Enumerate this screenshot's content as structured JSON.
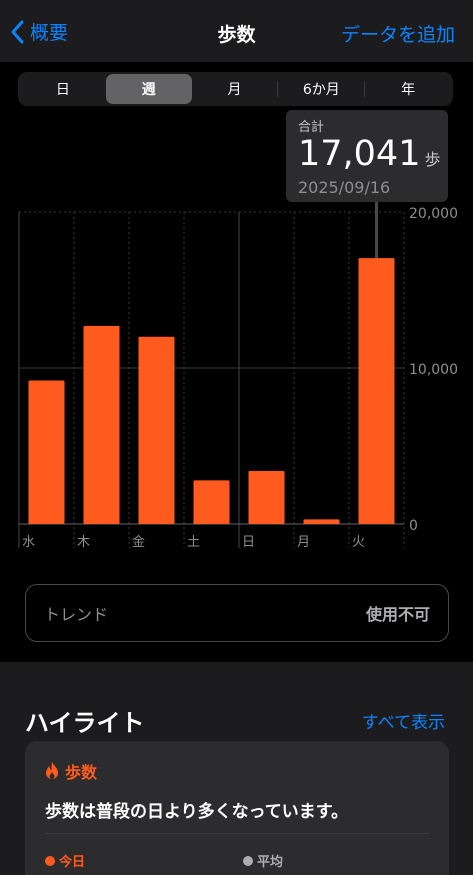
{
  "header": {
    "back_label": "概要",
    "title": "歩数",
    "add_label": "データを追加"
  },
  "segments": [
    {
      "label": "日",
      "active": false
    },
    {
      "label": "週",
      "active": true
    },
    {
      "label": "月",
      "active": false
    },
    {
      "label": "6か月",
      "active": false
    },
    {
      "label": "年",
      "active": false
    }
  ],
  "tooltip": {
    "label": "合計",
    "value": "17,041",
    "unit": "歩",
    "date": "2025/09/16"
  },
  "chart_data": {
    "type": "bar",
    "categories": [
      "水",
      "木",
      "金",
      "土",
      "日",
      "月",
      "火"
    ],
    "values": [
      9200,
      12700,
      12000,
      2800,
      3400,
      300,
      17041
    ],
    "y_ticks": [
      "20,000",
      "10,000",
      "0"
    ],
    "ylim": [
      0,
      20000
    ],
    "bar_color": "#ff5b1f",
    "selected_index": 6
  },
  "trend": {
    "label": "トレンド",
    "value": "使用不可"
  },
  "highlights": {
    "title": "ハイライト",
    "show_all": "すべて表示",
    "card": {
      "category": "歩数",
      "message": "歩数は普段の日より多くなっています。",
      "legend_today": "今日",
      "legend_avg": "平均"
    }
  },
  "colors": {
    "accent": "#0a84ff",
    "steps": "#ff5b1f"
  }
}
